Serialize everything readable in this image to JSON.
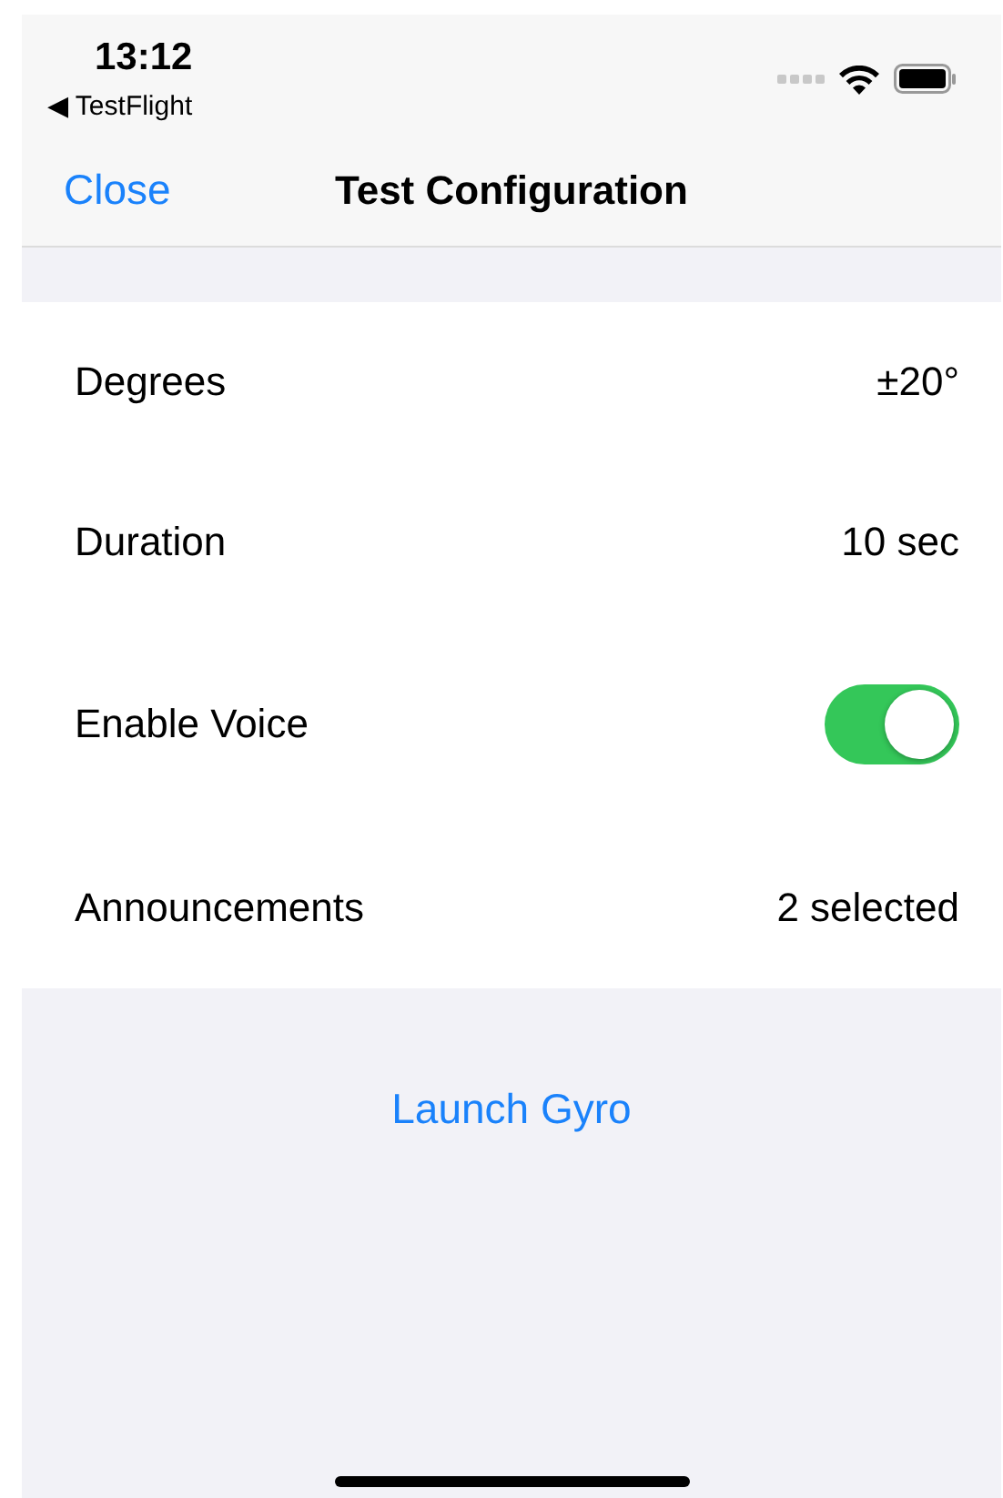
{
  "status_bar": {
    "time": "13:12",
    "back_app": "◀ TestFlight"
  },
  "nav_bar": {
    "left_button": "Close",
    "title": "Test Configuration"
  },
  "rows": [
    {
      "kind": "value",
      "label": "Degrees",
      "value": "±20°"
    },
    {
      "kind": "value",
      "label": "Duration",
      "value": "10 sec"
    },
    {
      "kind": "toggle",
      "label": "Enable Voice",
      "on": true
    },
    {
      "kind": "value",
      "label": "Announcements",
      "value": "2 selected"
    }
  ],
  "action_button": "Launch Gyro"
}
